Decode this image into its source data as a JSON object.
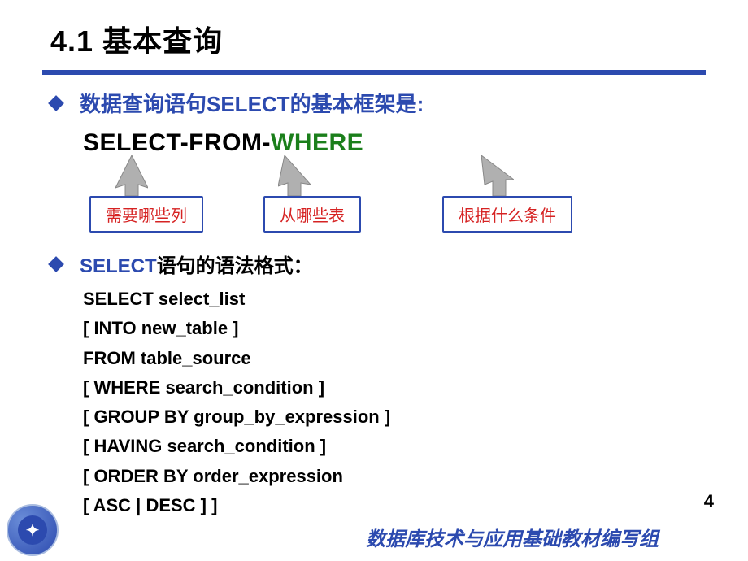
{
  "title": "4.1  基本查询",
  "bullet1": "数据查询语句SELECT的基本框架是:",
  "sfw": {
    "p1": "SELECT-FROM-",
    "p2": "WHERE"
  },
  "callouts": {
    "c1": "需要哪些列",
    "c2": "从哪些表",
    "c3": "根据什么条件"
  },
  "bullet2_blue": "SELECT",
  "bullet2_rest": "语句的语法格式：",
  "syntax": [
    "SELECT select_list",
    "[ INTO new_table ]",
    "FROM table_source",
    "[ WHERE search_condition ]",
    "[ GROUP BY group_by_expression ]",
    "[ HAVING search_condition ]",
    "[ ORDER BY order_expression",
    "[ ASC | DESC ] ]"
  ],
  "page_number": "4",
  "footer": "数据库技术与应用基础教材编写组"
}
